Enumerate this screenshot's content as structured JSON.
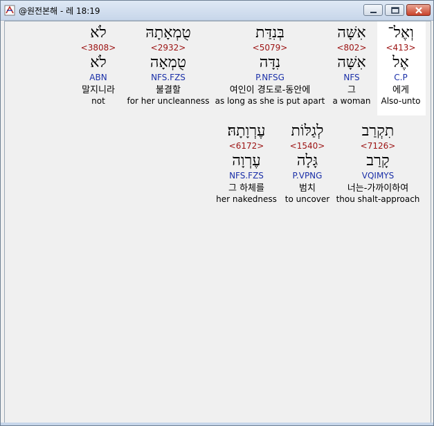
{
  "window": {
    "title": "@원전본해 - 레 18:19"
  },
  "rows": [
    [
      {
        "hebrew": "וְאֶל־",
        "strong": "<413>",
        "lemma": "אֶל",
        "morph": "C.P",
        "korean": "에게",
        "english": "Also-unto",
        "highlighted": true
      },
      {
        "hebrew": "אִשָּׁה",
        "strong": "<802>",
        "lemma": "אִשָּׁה",
        "morph": "NFS",
        "korean": "그",
        "english": "a woman"
      },
      {
        "hebrew": "בְּנִדַּת",
        "strong": "<5079>",
        "lemma": "נִדָּה",
        "morph": "P.NFSG",
        "korean": "여인이 경도로-동안에",
        "english": "as long as she is put apart"
      },
      {
        "hebrew": "טֻמְאָתָהּ",
        "strong": "<2932>",
        "lemma": "טֻמְאָה",
        "morph": "NFS.FZS",
        "korean": "불결할",
        "english": "for her uncleanness"
      },
      {
        "hebrew": "לֹא",
        "strong": "<3808>",
        "lemma": "לֹא",
        "morph": "ABN",
        "korean": "말지니라",
        "english": "not"
      }
    ],
    [
      {
        "hebrew": "תִקְרַב",
        "strong": "<7126>",
        "lemma": "קָרַב",
        "morph": "VQIMYS",
        "korean": "너는-가까이하여",
        "english": "thou shalt-approach"
      },
      {
        "hebrew": "לְגַלּוֹת",
        "strong": "<1540>",
        "lemma": "גָּלָה",
        "morph": "P.VPNG",
        "korean": "범치",
        "english": "to uncover"
      },
      {
        "hebrew": "עֶרְוָתָהּ׃",
        "strong": "<6172>",
        "lemma": "עֶרְוָה",
        "morph": "NFS.FZS",
        "korean": "그 하체를",
        "english": "her nakedness"
      }
    ]
  ]
}
